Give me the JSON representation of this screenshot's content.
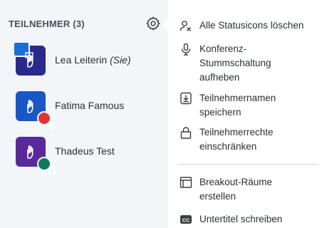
{
  "participants_panel": {
    "title": "TEILNEHMER (3)",
    "participants": [
      {
        "name": "Lea Leiterin",
        "suffix": "(Sie)",
        "avatar_color": "#2a2a8c",
        "status": "presenter"
      },
      {
        "name": "Fatima Famous",
        "suffix": "",
        "avatar_color": "#1857c4",
        "status": "muted"
      },
      {
        "name": "Thadeus Test",
        "suffix": "",
        "avatar_color": "#5a2a9c",
        "status": "listen-only"
      }
    ]
  },
  "options_menu": {
    "items": [
      {
        "label": "Alle Statusicons löschen",
        "icon": "clear-status-icon"
      },
      {
        "label": "Konferenz-Stummschaltung aufheben",
        "icon": "microphone-icon"
      },
      {
        "label": "Teilnehmernamen speichern",
        "icon": "download-icon"
      },
      {
        "label": "Teilnehmerrechte einschränken",
        "icon": "lock-icon"
      },
      {
        "label": "Breakout-Räume erstellen",
        "icon": "rooms-icon"
      },
      {
        "label": "Untertitel schreiben",
        "icon": "closed-captions-icon"
      }
    ]
  },
  "colors": {
    "muted_badge": "#e0362c",
    "listen_badge": "#0f7a5a",
    "presenter_badge": "#1b6fd3"
  }
}
